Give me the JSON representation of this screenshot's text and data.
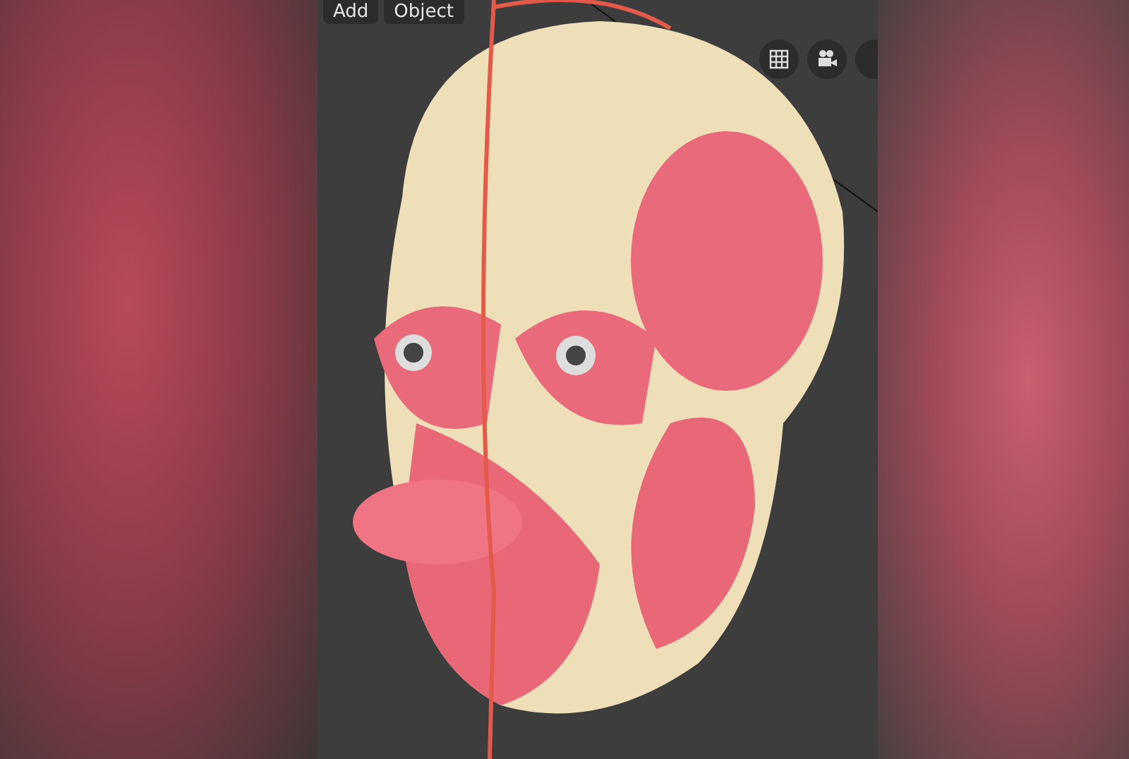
{
  "viewport_header": {
    "menus": [
      {
        "label": "Add"
      },
      {
        "label": "Object"
      }
    ]
  }
}
